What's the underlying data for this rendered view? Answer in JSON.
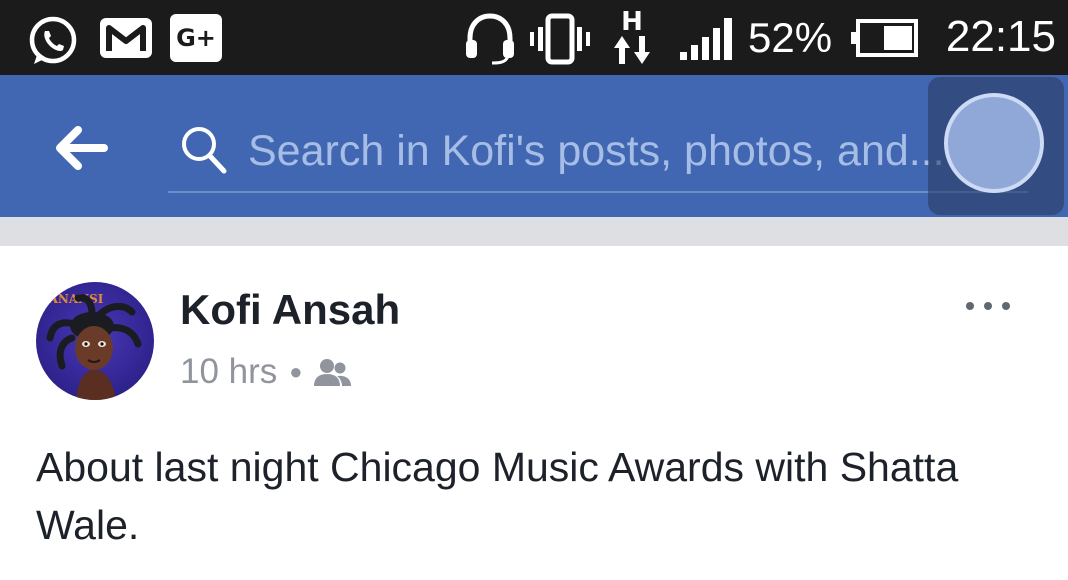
{
  "status_bar": {
    "notification_icons": [
      "whatsapp-icon",
      "gmail-icon",
      "google-plus-icon"
    ],
    "gplus_label": "G+",
    "system_icons": [
      "headset-icon",
      "vibrate-icon",
      "hspa-data-icon",
      "signal-icon",
      "battery-icon"
    ],
    "data_type": "H",
    "battery": "52%",
    "time": "22:15"
  },
  "header": {
    "background": "#4267b2",
    "search_placeholder": "Search in Kofi's posts, photos, and..."
  },
  "post": {
    "author": "Kofi Ansah",
    "avatar_caption": "ANANSI",
    "time": "10 hrs",
    "privacy_icon": "friends-icon",
    "more_icon": "more-options-icon",
    "text": "About last night Chicago Music Awards with Shatta Wale."
  }
}
